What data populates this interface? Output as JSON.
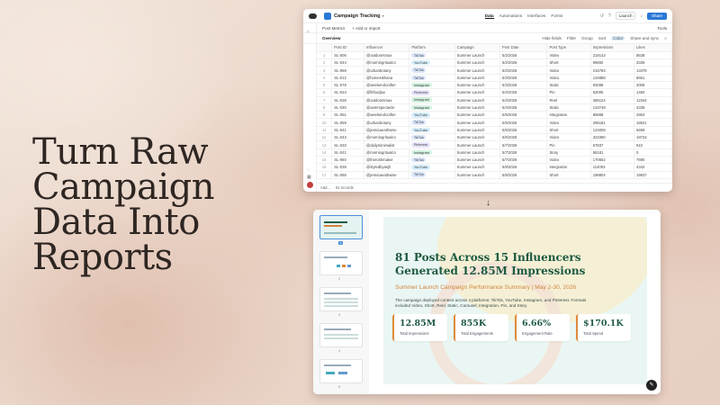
{
  "headline": {
    "lines": [
      "Turn Raw",
      "Campaign",
      "Data Into",
      "Reports"
    ]
  },
  "table_app": {
    "title": "Campaign Tracking",
    "nav": [
      "Data",
      "Automations",
      "Interfaces",
      "Forms"
    ],
    "launch_label": "Launch",
    "share_label": "Share",
    "subbar": {
      "table_name": "Post Metrics",
      "add_label": "+ Add or import",
      "tools_label": "Tools"
    },
    "view_name": "Overview",
    "tools": [
      "Hide fields",
      "Filter",
      "Group",
      "Sort",
      "Color",
      "Share and sync"
    ],
    "columns": [
      "",
      "Post ID",
      "Influencer",
      "Platform",
      "Campaign",
      "Post Date",
      "Post Type",
      "Impressions",
      "Likes"
    ],
    "rows": [
      [
        "1",
        "SL-006",
        "@outdoorsmax",
        "TikTok",
        "Summer Launch",
        "5/2/2026",
        "Video",
        "218143",
        "8638"
      ],
      [
        "2",
        "SL-044",
        "@morningritualco",
        "YouTube",
        "Summer Launch",
        "5/2/2026",
        "Short",
        "89692",
        "3336"
      ],
      [
        "3",
        "SL-069",
        "@urbanbotany",
        "TikTok",
        "Summer Launch",
        "5/2/2026",
        "Video",
        "215783",
        "13378"
      ],
      [
        "4",
        "SL-012",
        "@homesikhana",
        "TikTok",
        "Summer Launch",
        "5/3/2026",
        "Video",
        "134888",
        "8651"
      ],
      [
        "5",
        "SL-078",
        "@weekendcrafter",
        "Instagram",
        "Summer Launch",
        "5/3/2026",
        "Static",
        "83098",
        "2008"
      ],
      [
        "6",
        "SL-024",
        "@fitfoodjax",
        "Pinterest",
        "Summer Launch",
        "5/4/2026",
        "Pin",
        "63005",
        "1450"
      ],
      [
        "7",
        "SL-035",
        "@outdoorsmax",
        "Instagram",
        "Summer Launch",
        "5/4/2026",
        "Reel",
        "366124",
        "12344"
      ],
      [
        "8",
        "SL-030",
        "@aeterspectacle",
        "Instagram",
        "Summer Launch",
        "5/4/2026",
        "Static",
        "123748",
        "4338"
      ],
      [
        "9",
        "SL-061",
        "@weekendcrafter",
        "YouTube",
        "Summer Launch",
        "5/5/2026",
        "Integration",
        "86658",
        "2953"
      ],
      [
        "10",
        "SL-059",
        "@urbanbotany",
        "TikTok",
        "Summer Launch",
        "5/5/2026",
        "Video",
        "295181",
        "18621"
      ],
      [
        "11",
        "SL-041",
        "@jessicaeathwise",
        "YouTube",
        "Summer Launch",
        "5/6/2026",
        "Short",
        "124008",
        "5699"
      ],
      [
        "12",
        "SL-043",
        "@morningritualco",
        "TikTok",
        "Summer Launch",
        "5/6/2026",
        "Video",
        "323360",
        "18724"
      ],
      [
        "13",
        "SL-033",
        "@dailyminimalist",
        "Pinterest",
        "Summer Launch",
        "5/7/2026",
        "Pin",
        "57837",
        "910"
      ],
      [
        "14",
        "SL-041",
        "@morningritualco",
        "Instagram",
        "Summer Launch",
        "5/7/2026",
        "Story",
        "66181",
        "0"
      ],
      [
        "15",
        "SL-060",
        "@theroshmaker",
        "TikTok",
        "Summer Launch",
        "5/7/2026",
        "Video",
        "170652",
        "7690"
      ],
      [
        "16",
        "SL-038",
        "@styledbyasjh",
        "YouTube",
        "Summer Launch",
        "5/8/2026",
        "Integration",
        "114053",
        "4342"
      ],
      [
        "17",
        "SL-066",
        "@jessicaeathwise",
        "TikTok",
        "Summer Launch",
        "5/8/2026",
        "Short",
        "198804",
        "19837"
      ]
    ],
    "footer_records": "81 records",
    "footer_add": "Add..."
  },
  "slides_app": {
    "title": "81 Posts Across 15 Influencers Generated 12.85M Impressions",
    "subtitle": "Summer Launch Campaign Performance Summary | May 2-30, 2026",
    "description": "The campaign deployed content across 4 platforms: TikTok, YouTube, Instagram, and Pinterest. Formats included Video, Short, Reel, Static, Carousel, Integration, Pin, and Story.",
    "kpis": [
      {
        "value": "12.85M",
        "label": "Total Impressions"
      },
      {
        "value": "855K",
        "label": "Total Engagements"
      },
      {
        "value": "6.66%",
        "label": "Engagement Rate"
      },
      {
        "value": "$170.1K",
        "label": "Total Spend"
      }
    ],
    "thumbnail_numbers": [
      "1",
      "2",
      "3",
      "4",
      "5"
    ],
    "selected_slide": 1
  },
  "platform_colors": {
    "TikTok": "#dbe7fb",
    "YouTube": "#d6eefb",
    "Instagram": "#d3f2e0",
    "Pinterest": "#e7e4fb"
  },
  "colors": {
    "accent": "#2a78d6",
    "slide_title": "#1d5a42",
    "slide_subtitle": "#d0843d",
    "kpi_border": "#e08a3a"
  }
}
